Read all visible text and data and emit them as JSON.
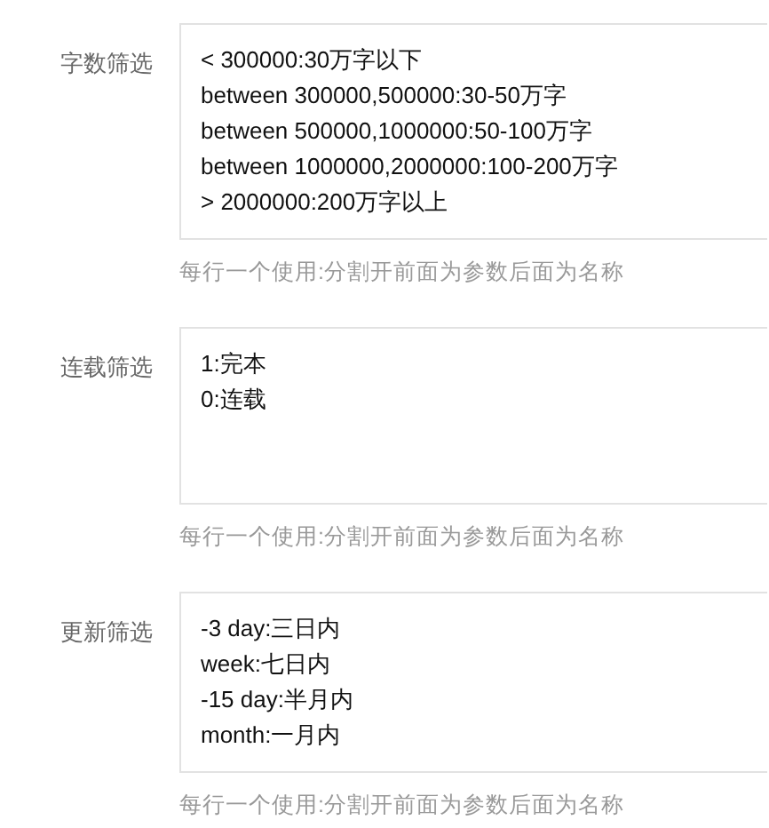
{
  "fields": [
    {
      "label": "字数筛选",
      "lines": [
        "< 300000:30万字以下",
        "between 300000,500000:30-50万字",
        "between 500000,1000000:50-100万字",
        "between 1000000,2000000:100-200万字",
        "> 2000000:200万字以上"
      ],
      "hint": "每行一个使用:分割开前面为参数后面为名称"
    },
    {
      "label": "连载筛选",
      "lines": [
        "1:完本",
        "0:连载"
      ],
      "hint": "每行一个使用:分割开前面为参数后面为名称"
    },
    {
      "label": "更新筛选",
      "lines": [
        "-3 day:三日内",
        "week:七日内",
        "-15 day:半月内",
        "month:一月内"
      ],
      "hint": "每行一个使用:分割开前面为参数后面为名称"
    }
  ]
}
